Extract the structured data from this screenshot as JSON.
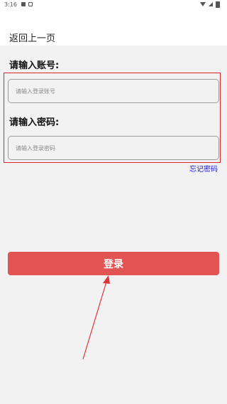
{
  "status_bar": {
    "time": "3:16",
    "icons": [
      "image-icon",
      "notification-icon",
      "wifi-icon",
      "signal-icon",
      "battery-icon"
    ]
  },
  "header": {
    "back_label": "返回上一页"
  },
  "form": {
    "account_label": "请输入账号:",
    "account_placeholder": "请输入登录账号",
    "password_label": "请输入密码:",
    "password_placeholder": "请输入登录密码",
    "forgot_password_label": "忘记密码",
    "login_button_label": "登录"
  },
  "colors": {
    "accent": "#e15453",
    "highlight": "#d9272e",
    "link": "#1a1ad6",
    "background": "#f2f2f2"
  }
}
